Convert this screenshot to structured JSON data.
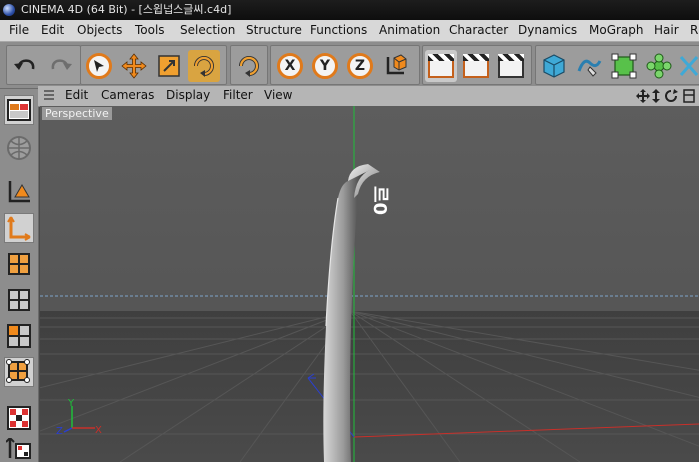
{
  "window": {
    "title": "CINEMA 4D (64 Bit) - [스윕넙스글씨.c4d]"
  },
  "menu": {
    "items": [
      "File",
      "Edit",
      "Objects",
      "Tools",
      "Selection",
      "Structure",
      "Functions",
      "Animation",
      "Character",
      "Dynamics",
      "MoGraph",
      "Hair",
      "R"
    ]
  },
  "toolbar": {
    "axis_x": "X",
    "axis_y": "Y",
    "axis_z": "Z",
    "accent_color": "#e07a1b",
    "active_color": "#d9a441"
  },
  "viewport_menu": {
    "items": [
      "Edit",
      "Cameras",
      "Display",
      "Filter",
      "View"
    ]
  },
  "viewport": {
    "label": "Perspective",
    "object_text": "르0",
    "axes": {
      "y": "Y",
      "x": "X",
      "z": "Z"
    },
    "colors": {
      "y_axis": "#1fbf3a",
      "x_axis": "#c8302a",
      "z_axis": "#2a3fd1",
      "horizon": "#7ea4c9"
    }
  }
}
